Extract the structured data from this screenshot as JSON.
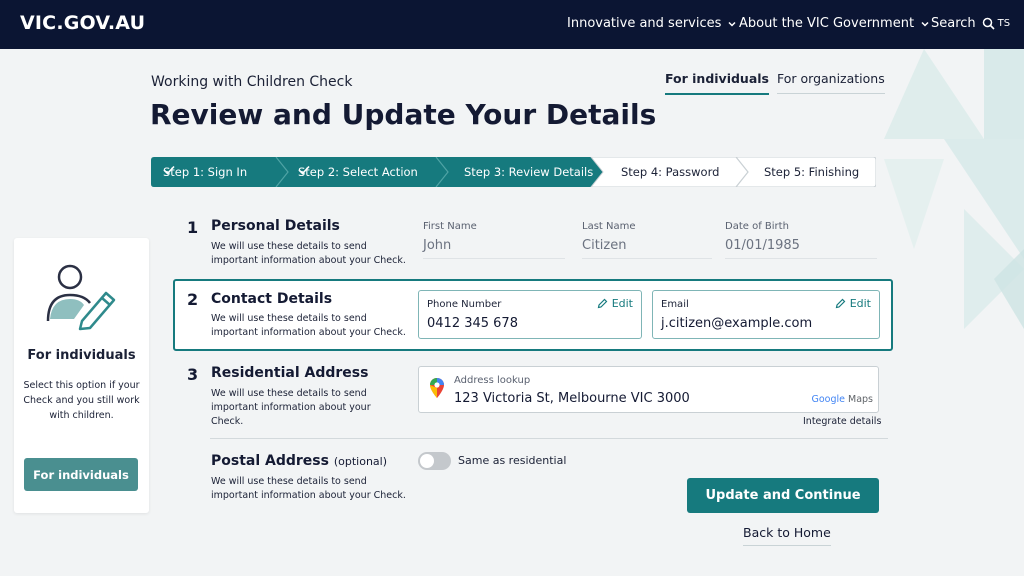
{
  "header": {
    "brand": "VIC.GOV.AU",
    "nav": [
      {
        "label": "Innovative and services"
      },
      {
        "label": "About the VIC Government"
      }
    ],
    "search_label": "Search",
    "user_initials": "TS"
  },
  "page": {
    "eyebrow": "Working with Children Check",
    "title": "Review and Update Your Details"
  },
  "audience_tabs": [
    {
      "label": "For individuals",
      "active": true
    },
    {
      "label": "For organizations",
      "active": false
    }
  ],
  "steps": [
    {
      "label": "Step 1: Sign In",
      "state": "done"
    },
    {
      "label": "Step 2: Select Action",
      "state": "done"
    },
    {
      "label": "Step 3: Review Details",
      "state": "current"
    },
    {
      "label": "Step 4: Password",
      "state": "todo"
    },
    {
      "label": "Step 5: Finishing",
      "state": "todo"
    }
  ],
  "side_card": {
    "title": "For individuals",
    "text": "Select this option if your Check and you still work with children.",
    "button": "For individuals"
  },
  "sections": {
    "personal": {
      "number": "1",
      "title": "Personal Details",
      "desc": "We will use these details to send important information about your Check.",
      "fields": [
        {
          "label": "First Name",
          "value": "John"
        },
        {
          "label": "Last Name",
          "value": "Citizen"
        },
        {
          "label": "Date of Birth",
          "value": "01/01/1985"
        }
      ]
    },
    "contact": {
      "number": "2",
      "title": "Contact Details",
      "desc": "We will use these details to send important information about your Check.",
      "phone": {
        "label": "Phone Number",
        "value": "0412 345 678",
        "edit": "Edit"
      },
      "email": {
        "label": "Email",
        "value": "j.citizen@example.com",
        "edit": "Edit"
      }
    },
    "residential": {
      "number": "3",
      "title": "Residential Address",
      "desc": "We will use these details to send important information about your Check.",
      "lookup_label": "Address lookup",
      "lookup_value": "123 Victoria St, Melbourne VIC 3000",
      "maps_brand": "Google",
      "maps_suffix": "Maps",
      "integrate": "Integrate details"
    },
    "postal": {
      "title": "Postal Address",
      "optional": "(optional)",
      "desc": "We will use these details to send important information about your Check.",
      "toggle_label": "Same as residential",
      "toggle_on": false
    }
  },
  "actions": {
    "primary": "Update and Continue",
    "back": "Back to Home"
  },
  "colors": {
    "navy": "#0b1533",
    "teal": "#167a7e",
    "teal_soft": "#4a8f90"
  }
}
